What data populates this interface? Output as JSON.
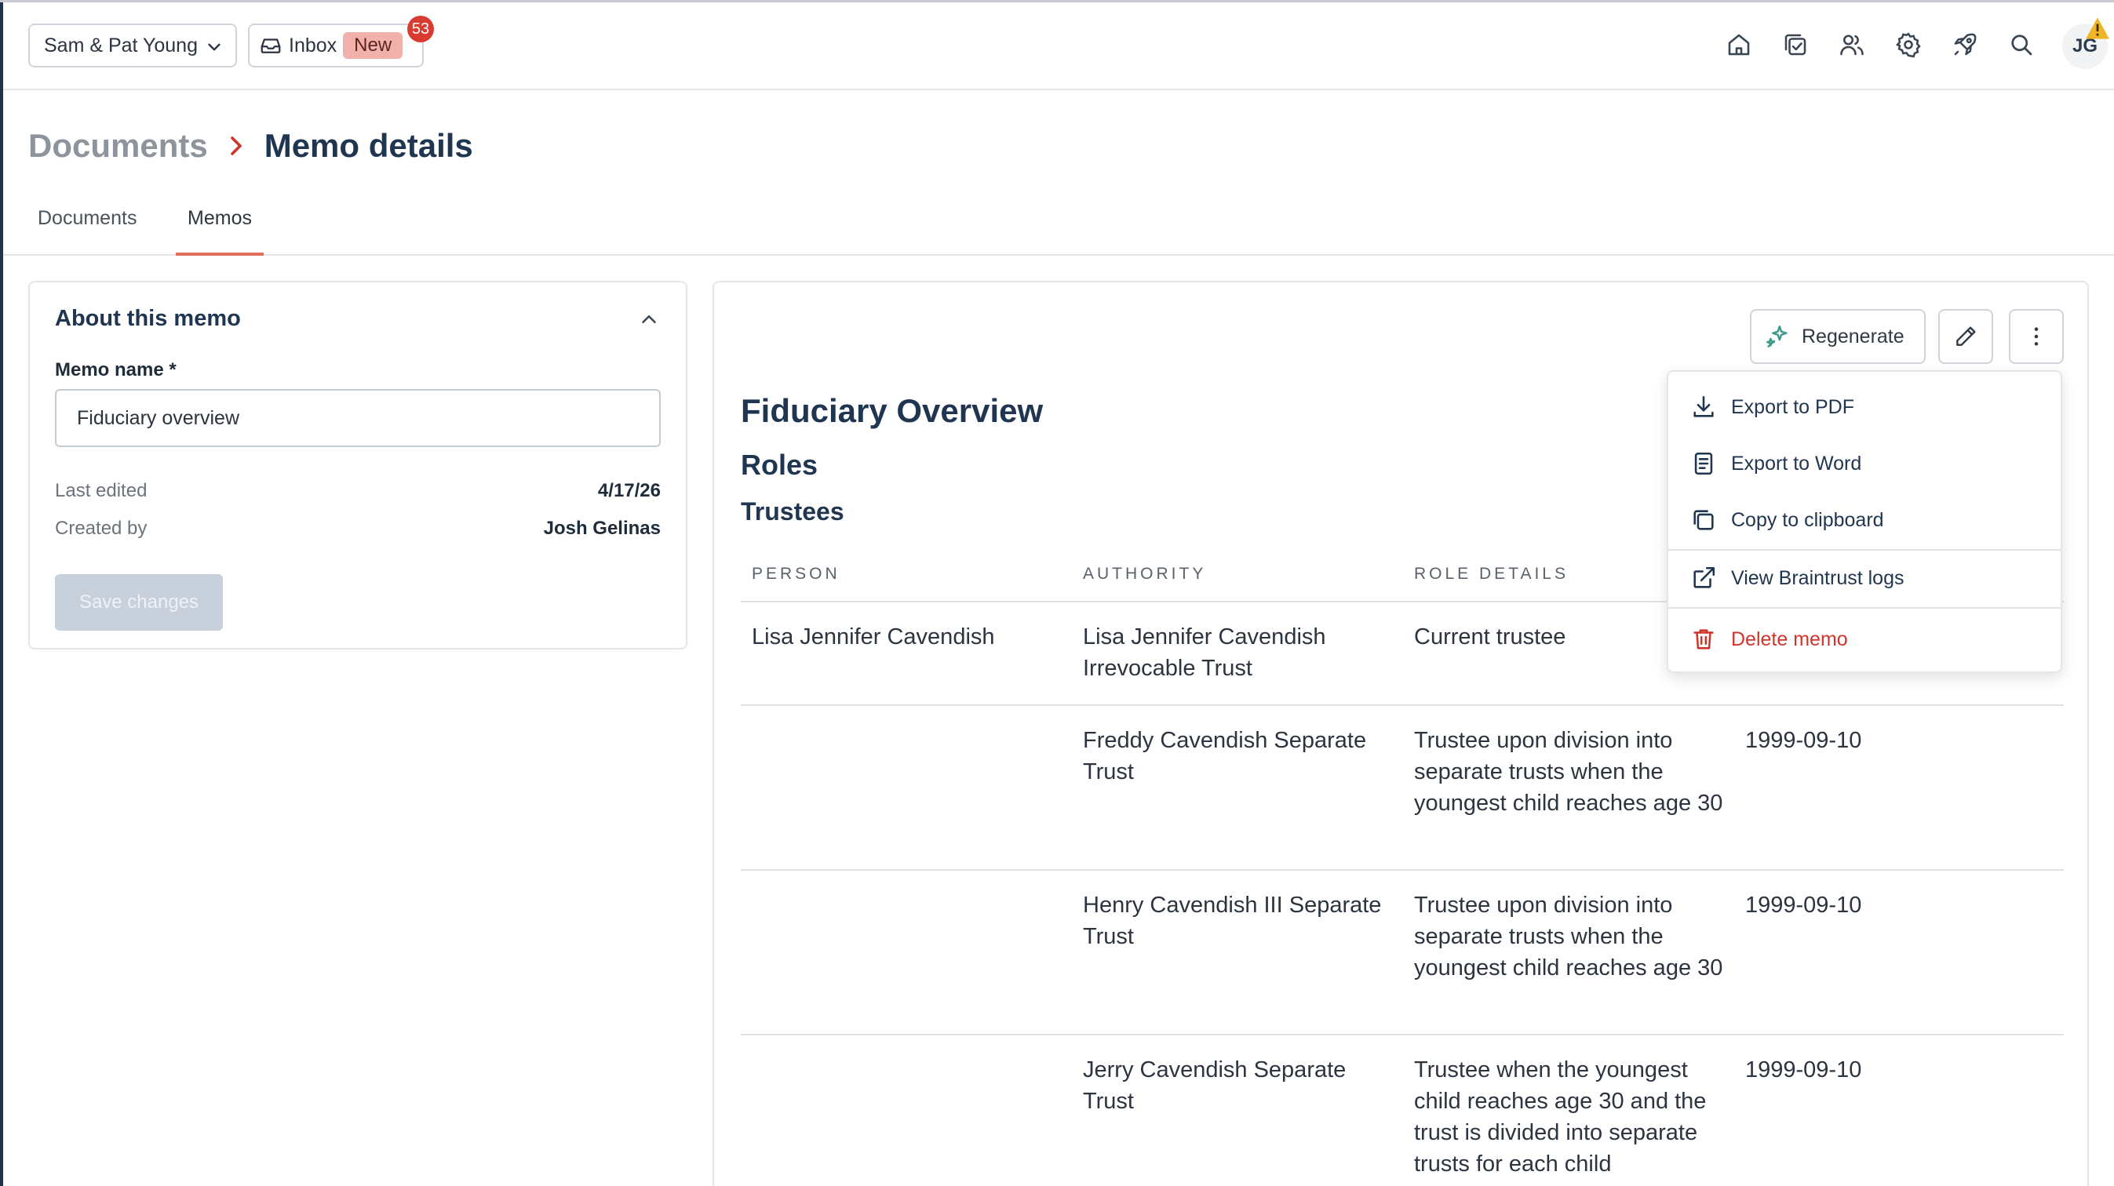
{
  "topbar": {
    "client_name": "Sam & Pat Young",
    "inbox_label": "Inbox",
    "inbox_new": "New",
    "inbox_count": "53",
    "user_initials": "JG",
    "icons": [
      "home-icon",
      "tasks-icon",
      "people-icon",
      "settings-icon",
      "rocket-icon",
      "search-icon"
    ]
  },
  "breadcrumb": {
    "root": "Documents",
    "current": "Memo details"
  },
  "tabs": {
    "documents": "Documents",
    "memos": "Memos",
    "active": "Memos"
  },
  "about": {
    "title": "About this memo",
    "memo_name_label": "Memo name *",
    "memo_name_value": "Fiduciary overview",
    "last_edited_label": "Last edited",
    "last_edited_value": "4/17/26",
    "created_by_label": "Created by",
    "created_by_value": "Josh Gelinas",
    "save_label": "Save changes"
  },
  "memo": {
    "regenerate_label": "Regenerate",
    "title": "Fiduciary Overview",
    "section": "Roles",
    "subsection": "Trustees",
    "columns": [
      "PERSON",
      "AUTHORITY",
      "ROLE DETAILS"
    ],
    "rows": [
      {
        "person": "Lisa Jennifer Cavendish",
        "authority": "Lisa Jennifer Cavendish Irrevocable Trust",
        "role": "Current trustee",
        "date": ""
      },
      {
        "person": "",
        "authority": "Freddy Cavendish Separate Trust",
        "role": "Trustee upon division into separate trusts when the youngest child reaches age 30",
        "date": "1999-09-10"
      },
      {
        "person": "",
        "authority": "Henry Cavendish III Separate Trust",
        "role": "Trustee upon division into separate trusts when the youngest child reaches age 30",
        "date": "1999-09-10"
      },
      {
        "person": "",
        "authority": "Jerry Cavendish Separate Trust",
        "role": "Trustee when the youngest child reaches age 30 and the trust is divided into separate trusts for each child",
        "date": "1999-09-10"
      }
    ]
  },
  "menu": {
    "export_pdf": "Export to PDF",
    "export_word": "Export to Word",
    "copy_clipboard": "Copy to clipboard",
    "braintrust_logs": "View Braintrust logs",
    "delete": "Delete memo"
  },
  "colors": {
    "navy": "#1f3550",
    "accent": "#e0705f",
    "danger": "#d0352b",
    "badge": "#d93b30",
    "new_pill": "#f2b0aa",
    "regenerate_icon": "#3a9a8a",
    "warning": "#f0b429"
  }
}
